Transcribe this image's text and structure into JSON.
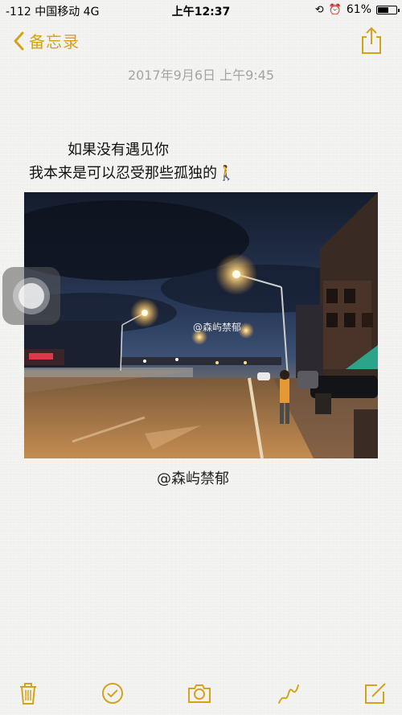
{
  "status_bar": {
    "carrier": "-112 中国移动  4G",
    "time": "上午12:37",
    "battery_percent": "61%",
    "battery_level": 0.61
  },
  "nav": {
    "back_label": "备忘录",
    "accent_color": "#d6a21e"
  },
  "note": {
    "date": "2017年9月6日 上午9:45",
    "line1": "如果没有遇见你",
    "line2": "我本来是可以忍受那些孤独的🚶",
    "image_watermark": "@森屿禁郁",
    "caption": "@森屿禁郁"
  },
  "toolbar": {
    "items": [
      "trash-icon",
      "checklist-icon",
      "camera-icon",
      "sketch-icon",
      "compose-icon"
    ]
  }
}
